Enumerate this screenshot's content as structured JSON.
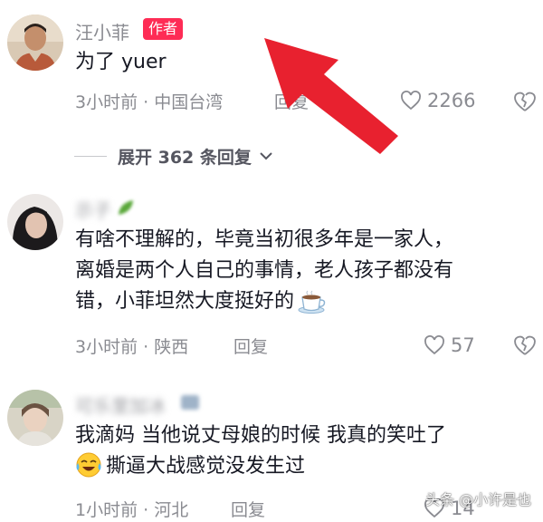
{
  "comments": [
    {
      "username": "汪小菲",
      "badge": "作者",
      "content_lines": [
        "为了 yuer"
      ],
      "meta": "3小时前 · 中国台湾",
      "reply_label": "回复",
      "like_count": "2266"
    },
    {
      "username": "示子",
      "content_lines": [
        "有啥不理解的，毕竟当初很多年是一家人，",
        "离婚是两个人自己的事情，老人孩子都没有",
        "错，小菲坦然大度挺好的"
      ],
      "meta": "3小时前 · 陕西",
      "reply_label": "回复",
      "like_count": "57"
    },
    {
      "username": "可乐里加冰",
      "content_lines": [
        "我滴妈 当他说丈母娘的时候 我真的笑吐了",
        "撕逼大战感觉没发生过"
      ],
      "meta": "1小时前 · 河北",
      "reply_label": "回复",
      "like_count": "14"
    }
  ],
  "expand_replies": "展开 362 条回复",
  "watermark": "头条 @小许是也",
  "icons": {
    "like": "heart-outline-icon",
    "dislike": "broken-heart-icon",
    "expand": "chevron-down-icon",
    "emoji_coffee": "coffee-cup-emoji",
    "emoji_laugh": "laughing-tears-emoji",
    "annotation": "red-arrow-icon"
  },
  "colors": {
    "badge": "#fe2c55",
    "arrow": "#e8212f",
    "secondary_text": "#8a8b91",
    "primary_text": "#161823"
  }
}
